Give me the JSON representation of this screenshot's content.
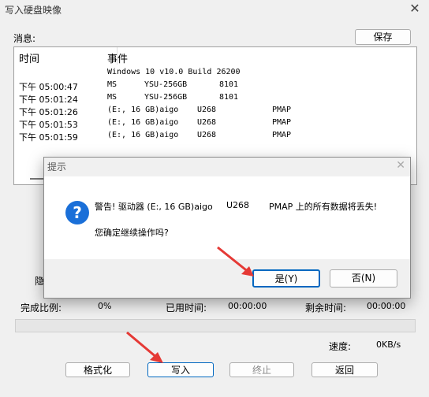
{
  "window": {
    "title": "写入硬盘映像",
    "close_icon": "✕"
  },
  "messages": {
    "label": "消息:",
    "save_label": "保存",
    "columns": {
      "time": "时间",
      "event": "事件"
    },
    "rows": [
      {
        "time": "",
        "event": "Windows 10 v10.0 Build 26200",
        "model": "",
        "id": "",
        "extra": ""
      },
      {
        "time": "下午 05:00:47",
        "event": "MS",
        "model": "YSU-256GB",
        "id": "8101",
        "extra": ""
      },
      {
        "time": "下午 05:01:24",
        "event": "MS",
        "model": "YSU-256GB",
        "id": "8101",
        "extra": ""
      },
      {
        "time": "下午 05:01:26",
        "event": "(E:, 16 GB)aigo",
        "model": "",
        "id": "U268",
        "extra": "PMAP"
      },
      {
        "time": "下午 05:01:53",
        "event": "(E:, 16 GB)aigo",
        "model": "",
        "id": "U268",
        "extra": "PMAP"
      },
      {
        "time": "下午 05:01:59",
        "event": "(E:, 16 GB)aigo",
        "model": "",
        "id": "U268",
        "extra": "PMAP"
      }
    ]
  },
  "hidden_label": "隐",
  "progress": {
    "complete_label": "完成比例:",
    "complete_value": "0%",
    "elapsed_label": "已用时间:",
    "elapsed_value": "00:00:00",
    "remaining_label": "剩余时间:",
    "remaining_value": "00:00:00",
    "fraction": 0,
    "speed_label": "速度:",
    "speed_value": "0KB/s"
  },
  "buttons": {
    "format": "格式化",
    "write": "写入",
    "stop": "终止",
    "back": "返回"
  },
  "dialog": {
    "title": "提示",
    "close_icon": "✕",
    "icon": "?",
    "warning_prefix": "警告! 驱动器 (E:, 16 GB)aigo",
    "warning_id": "U268",
    "warning_suffix": "PMAP 上的所有数据将丢失!",
    "question": "您确定继续操作吗?",
    "yes_label": "是(Y)",
    "no_label": "否(N)"
  },
  "colors": {
    "accent": "#1a6fd8",
    "arrow": "#e53935",
    "focus": "#0067c0"
  }
}
